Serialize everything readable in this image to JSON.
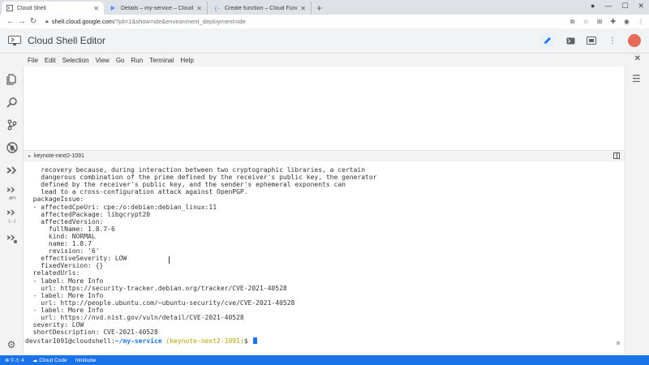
{
  "browser": {
    "tabs": [
      {
        "title": "Cloud Shell",
        "active": true
      },
      {
        "title": "Details – my-service – Cloud Ru…",
        "active": false
      },
      {
        "title": "Create function – Cloud Functio…",
        "active": false
      }
    ],
    "new_tab": "+",
    "tab_close": "✕",
    "url_host": "shell.cloud.google.com",
    "url_path": "/?pli=1&show=ide&environment_deployment=ide"
  },
  "app": {
    "title": "Cloud Shell Editor"
  },
  "menu": [
    "File",
    "Edit",
    "Selection",
    "View",
    "Go",
    "Run",
    "Terminal",
    "Help"
  ],
  "activity": {
    "api_label": "API",
    "brackets_label": "{…}"
  },
  "panel": {
    "terminal_tab": "keynote-next2-1091"
  },
  "terminal": {
    "lines": [
      "    recovery because, during interaction between two cryptographic libraries, a certain",
      "    dangerous combination of the prime defined by the receiver's public key, the generator",
      "    defined by the receiver's public key, and the sender's ephemeral exponents can",
      "    lead to a cross-configuration attack against OpenPGP.",
      "  packageIssue:",
      "  - affectedCpeUri: cpe:/o:debian:debian_linux:11",
      "    affectedPackage: libgcrypt20",
      "    affectedVersion:",
      "      fullName: 1.8.7-6",
      "      kind: NORMAL",
      "      name: 1.8.7",
      "      revision: '6'",
      "    effectiveSeverity: LOW",
      "    fixedVersion: {}",
      "  relatedUrls:",
      "  - label: More Info",
      "    url: https://security-tracker.debian.org/tracker/CVE-2021-40528",
      "  - label: More Info",
      "    url: http://people.ubuntu.com/~ubuntu-security/cve/CVE-2021-40528",
      "  - label: More Info",
      "    url: https://nvd.nist.gov/vuln/detail/CVE-2021-40528",
      "  severity: LOW",
      "  shortDescription: CVE-2021-40528"
    ],
    "prompt_user": "devstar1091@cloudshell:",
    "prompt_path": "~/my-service",
    "prompt_project": "(keynote-next2-1091)",
    "prompt_symbol": "$"
  },
  "status": {
    "problems": "⊗ 0 ⚠ 4",
    "cloud_code": "☁ Cloud Code",
    "cluster": "minikube"
  },
  "colors": {
    "accent": "#1a73e8",
    "project": "#b8a200"
  }
}
